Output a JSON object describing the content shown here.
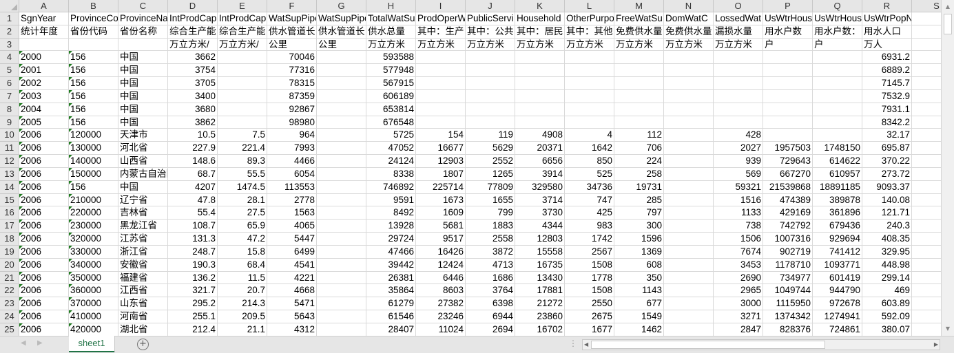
{
  "columns": [
    "A",
    "B",
    "C",
    "D",
    "E",
    "F",
    "G",
    "H",
    "I",
    "J",
    "K",
    "L",
    "M",
    "N",
    "O",
    "P",
    "Q",
    "R",
    "S"
  ],
  "header_rows": [
    [
      "SgnYear",
      "ProvinceCode",
      "ProvinceName",
      "IntProdCap",
      "IntProdCap",
      "WatSupPipe",
      "WatSupPipe",
      "TotalWatSup",
      "ProdOperW",
      "PublicServi",
      "Household",
      "OtherPurpo",
      "FreeWatSu",
      "DomWatC",
      "LossedWat",
      "UsWtrHous",
      "UsWtrHous",
      "UsWtrPopNum"
    ],
    [
      "统计年度",
      "省份代码",
      "省份名称",
      "综合生产能",
      "综合生产能",
      "供水管道长",
      "供水管道长",
      "供水总量",
      "其中：生产",
      "其中：公共",
      "其中：居民",
      "其中：其他",
      "免费供水量",
      "免费供水量",
      "漏损水量",
      "用水户数",
      "用水户数：",
      "用水人口"
    ],
    [
      "",
      "",
      "",
      "万立方米/",
      "万立方米/",
      "公里",
      "公里",
      "万立方米",
      "万立方米",
      "万立方米",
      "万立方米",
      "万立方米",
      "万立方米",
      "万立方米",
      "万立方米",
      "户",
      "户",
      "万人"
    ]
  ],
  "data_rows": [
    [
      "2000",
      "156",
      "中国",
      "3662",
      "",
      "70046",
      "",
      "593588",
      "",
      "",
      "",
      "",
      "",
      "",
      "",
      "",
      "",
      "6931.2"
    ],
    [
      "2001",
      "156",
      "中国",
      "3754",
      "",
      "77316",
      "",
      "577948",
      "",
      "",
      "",
      "",
      "",
      "",
      "",
      "",
      "",
      "6889.2"
    ],
    [
      "2002",
      "156",
      "中国",
      "3705",
      "",
      "78315",
      "",
      "567915",
      "",
      "",
      "",
      "",
      "",
      "",
      "",
      "",
      "",
      "7145.7"
    ],
    [
      "2003",
      "156",
      "中国",
      "3400",
      "",
      "87359",
      "",
      "606189",
      "",
      "",
      "",
      "",
      "",
      "",
      "",
      "",
      "",
      "7532.9"
    ],
    [
      "2004",
      "156",
      "中国",
      "3680",
      "",
      "92867",
      "",
      "653814",
      "",
      "",
      "",
      "",
      "",
      "",
      "",
      "",
      "",
      "7931.1"
    ],
    [
      "2005",
      "156",
      "中国",
      "3862",
      "",
      "98980",
      "",
      "676548",
      "",
      "",
      "",
      "",
      "",
      "",
      "",
      "",
      "",
      "8342.2"
    ],
    [
      "2006",
      "120000",
      "天津市",
      "10.5",
      "7.5",
      "964",
      "",
      "5725",
      "154",
      "119",
      "4908",
      "4",
      "112",
      "",
      "428",
      "",
      "",
      "32.17"
    ],
    [
      "2006",
      "130000",
      "河北省",
      "227.9",
      "221.4",
      "7993",
      "",
      "47052",
      "16677",
      "5629",
      "20371",
      "1642",
      "706",
      "",
      "2027",
      "1957503",
      "1748150",
      "695.87"
    ],
    [
      "2006",
      "140000",
      "山西省",
      "148.6",
      "89.3",
      "4466",
      "",
      "24124",
      "12903",
      "2552",
      "6656",
      "850",
      "224",
      "",
      "939",
      "729643",
      "614622",
      "370.22"
    ],
    [
      "2006",
      "150000",
      "内蒙古自治区",
      "68.7",
      "55.5",
      "6054",
      "",
      "8338",
      "1807",
      "1265",
      "3914",
      "525",
      "258",
      "",
      "569",
      "667270",
      "610957",
      "273.72"
    ],
    [
      "2006",
      "156",
      "中国",
      "4207",
      "1474.5",
      "113553",
      "",
      "746892",
      "225714",
      "77809",
      "329580",
      "34736",
      "19731",
      "",
      "59321",
      "21539868",
      "18891185",
      "9093.37"
    ],
    [
      "2006",
      "210000",
      "辽宁省",
      "47.8",
      "28.1",
      "2778",
      "",
      "9591",
      "1673",
      "1655",
      "3714",
      "747",
      "285",
      "",
      "1516",
      "474389",
      "389878",
      "140.08"
    ],
    [
      "2006",
      "220000",
      "吉林省",
      "55.4",
      "27.5",
      "1563",
      "",
      "8492",
      "1609",
      "799",
      "3730",
      "425",
      "797",
      "",
      "1133",
      "429169",
      "361896",
      "121.71"
    ],
    [
      "2006",
      "230000",
      "黑龙江省",
      "108.7",
      "65.9",
      "4065",
      "",
      "13928",
      "5681",
      "1883",
      "4344",
      "983",
      "300",
      "",
      "738",
      "742792",
      "679436",
      "240.3"
    ],
    [
      "2006",
      "320000",
      "江苏省",
      "131.3",
      "47.2",
      "5447",
      "",
      "29724",
      "9517",
      "2558",
      "12803",
      "1742",
      "1596",
      "",
      "1506",
      "1007316",
      "929694",
      "408.35"
    ],
    [
      "2006",
      "330000",
      "浙江省",
      "248.7",
      "15.8",
      "6499",
      "",
      "47466",
      "16426",
      "3872",
      "15558",
      "2567",
      "1369",
      "",
      "7674",
      "902719",
      "741412",
      "329.95"
    ],
    [
      "2006",
      "340000",
      "安徽省",
      "190.3",
      "68.4",
      "4541",
      "",
      "39442",
      "12424",
      "4713",
      "16735",
      "1508",
      "608",
      "",
      "3453",
      "1178710",
      "1093771",
      "448.98"
    ],
    [
      "2006",
      "350000",
      "福建省",
      "136.2",
      "11.5",
      "4221",
      "",
      "26381",
      "6446",
      "1686",
      "13430",
      "1778",
      "350",
      "",
      "2690",
      "734977",
      "601419",
      "299.14"
    ],
    [
      "2006",
      "360000",
      "江西省",
      "321.7",
      "20.7",
      "4668",
      "",
      "35864",
      "8603",
      "3764",
      "17881",
      "1508",
      "1143",
      "",
      "2965",
      "1049744",
      "944790",
      "469"
    ],
    [
      "2006",
      "370000",
      "山东省",
      "295.2",
      "214.3",
      "5471",
      "",
      "61279",
      "27382",
      "6398",
      "21272",
      "2550",
      "677",
      "",
      "3000",
      "1115950",
      "972678",
      "603.89"
    ],
    [
      "2006",
      "410000",
      "河南省",
      "255.1",
      "209.5",
      "5643",
      "",
      "61546",
      "23246",
      "6944",
      "23860",
      "2675",
      "1549",
      "",
      "3271",
      "1374342",
      "1274941",
      "592.09"
    ],
    [
      "2006",
      "420000",
      "湖北省",
      "212.4",
      "21.1",
      "4312",
      "",
      "28407",
      "11024",
      "2694",
      "16702",
      "1677",
      "1462",
      "",
      "2847",
      "828376",
      "724861",
      "380.07"
    ]
  ],
  "sheet_tab": "sheet1",
  "add_sheet_icon": "plus-circle-icon",
  "accent_color": "#217346"
}
